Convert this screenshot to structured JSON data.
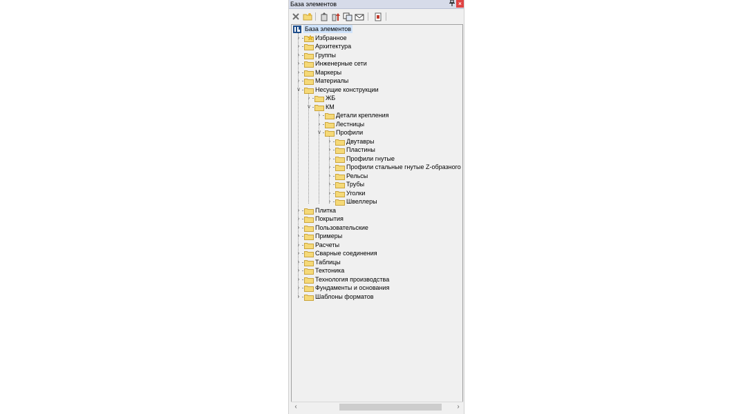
{
  "window": {
    "title": "База элементов",
    "pin_glyph": "ᵖ",
    "close_glyph": "×"
  },
  "toolbar": {
    "buttons": [
      {
        "icon": "delete-icon"
      },
      {
        "icon": "new-folder-icon"
      },
      {
        "icon": "import-icon"
      },
      {
        "icon": "export-icon"
      },
      {
        "icon": "copy-icon"
      },
      {
        "icon": "mail-icon"
      },
      {
        "icon": "document-icon"
      }
    ]
  },
  "tree": {
    "root": "База элементов",
    "items": [
      {
        "label": "Избранное",
        "icon": "star-folder-icon"
      },
      {
        "label": "Архитектура"
      },
      {
        "label": "Группы"
      },
      {
        "label": "Инженерные сети"
      },
      {
        "label": "Маркеры"
      },
      {
        "label": "Материалы"
      },
      {
        "label": "Несущие конструкции",
        "expanded": true,
        "children": [
          {
            "label": "ЖБ"
          },
          {
            "label": "КМ",
            "expanded": true,
            "children": [
              {
                "label": "Детали крепления"
              },
              {
                "label": "Лестницы"
              },
              {
                "label": "Профили",
                "expanded": true,
                "children": [
                  {
                    "label": "Двутавры"
                  },
                  {
                    "label": "Пластины"
                  },
                  {
                    "label": "Профили гнутые"
                  },
                  {
                    "label": "Профили стальные гнутые Z-образного сечения"
                  },
                  {
                    "label": "Рельсы"
                  },
                  {
                    "label": "Трубы"
                  },
                  {
                    "label": "Уголки"
                  },
                  {
                    "label": "Швеллеры"
                  }
                ]
              }
            ]
          }
        ]
      },
      {
        "label": "Плитка"
      },
      {
        "label": "Покрытия"
      },
      {
        "label": "Пользовательские"
      },
      {
        "label": "Примеры"
      },
      {
        "label": "Расчеты"
      },
      {
        "label": "Сварные соединения"
      },
      {
        "label": "Таблицы"
      },
      {
        "label": "Тектоника"
      },
      {
        "label": "Технология производства"
      },
      {
        "label": "Фундаменты и основания"
      },
      {
        "label": "Шаблоны форматов"
      }
    ]
  },
  "scrollbar": {
    "left_glyph": "‹",
    "right_glyph": "›"
  },
  "colors": {
    "folder": "#f5d978",
    "folder_edge": "#c9a33a",
    "selection": "#cfe3fb",
    "close": "#e04343"
  }
}
